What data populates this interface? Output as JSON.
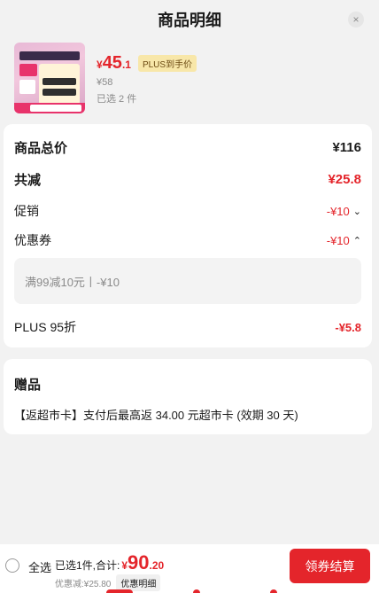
{
  "header": {
    "title": "商品明细",
    "close_icon": "×"
  },
  "product": {
    "price_currency": "¥",
    "price_int": "45",
    "price_dec": ".1",
    "plus_tag": "PLUS到手价",
    "original_price": "¥58",
    "selected_count": "已选 2 件"
  },
  "summary_card": {
    "total_label": "商品总价",
    "total_value": "¥116",
    "reduce_label": "共减",
    "reduce_value": "¥25.8",
    "promo_label": "促销",
    "promo_value": "-¥10",
    "promo_chevron": "⌄",
    "coupon_label": "优惠券",
    "coupon_value": "-¥10",
    "coupon_chevron": "⌃",
    "coupon_detail": "满99减10元丨-¥10",
    "plus_label": "PLUS 95折",
    "plus_value": "-¥5.8"
  },
  "gift_card": {
    "title": "赠品",
    "text": "【返超市卡】支付后最高返 34.00 元超市卡 (效期 30 天)"
  },
  "bottom_bar": {
    "select_all": "全选",
    "summary_label": "已选1件,合计:",
    "total_currency": "¥",
    "total_int": "90",
    "total_dec": ".20",
    "discount_text": "优惠减:¥25.80",
    "detail_button": "优惠明细",
    "checkout_button": "领券结算"
  },
  "colors": {
    "accent": "#e4252b",
    "plus_tag_bg": "#f8e7a9"
  }
}
